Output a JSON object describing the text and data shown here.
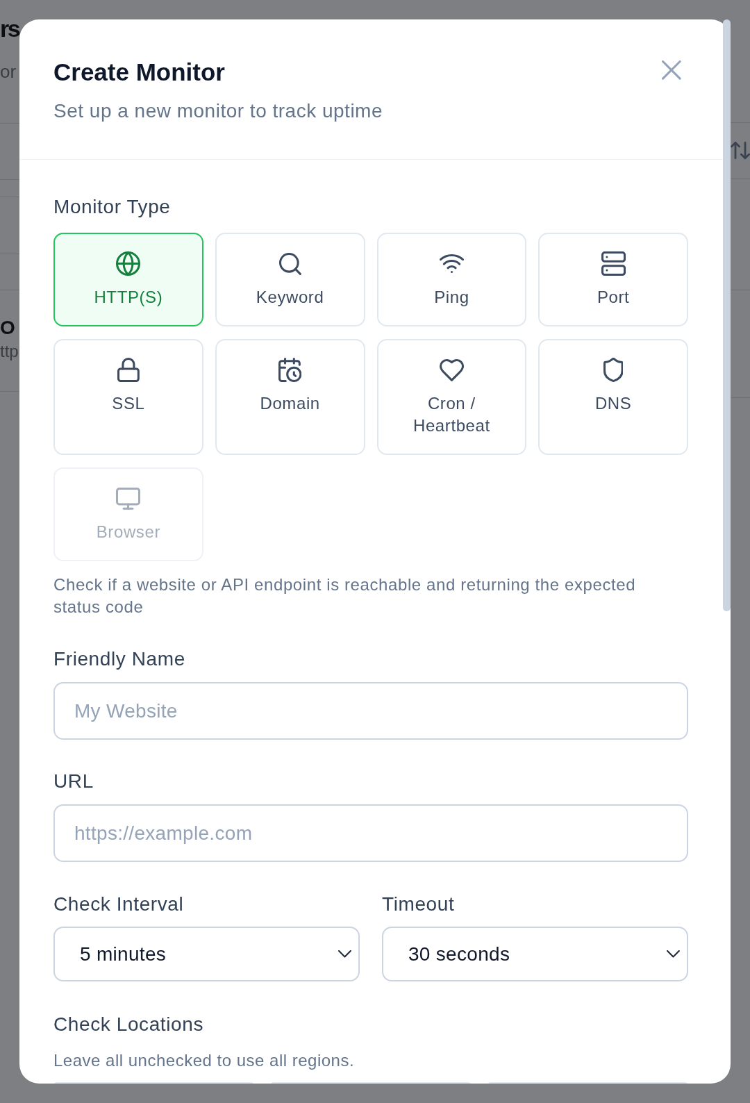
{
  "backdrop": {
    "page_title": "rs",
    "page_subtitle": "or",
    "monitor_name": "O",
    "monitor_url": "ttp"
  },
  "dialog": {
    "title": "Create Monitor",
    "subtitle": "Set up a new monitor to track uptime"
  },
  "monitor_type": {
    "label": "Monitor Type",
    "options": [
      {
        "label": "HTTP(S)",
        "selected": true,
        "disabled": false
      },
      {
        "label": "Keyword",
        "selected": false,
        "disabled": false
      },
      {
        "label": "Ping",
        "selected": false,
        "disabled": false
      },
      {
        "label": "Port",
        "selected": false,
        "disabled": false
      },
      {
        "label": "SSL",
        "selected": false,
        "disabled": false
      },
      {
        "label": "Domain",
        "selected": false,
        "disabled": false
      },
      {
        "label": "Cron / Heartbeat",
        "selected": false,
        "disabled": false
      },
      {
        "label": "DNS",
        "selected": false,
        "disabled": false
      },
      {
        "label": "Browser",
        "selected": false,
        "disabled": true
      }
    ],
    "description": "Check if a website or API endpoint is reachable and returning the expected status code"
  },
  "friendly_name": {
    "label": "Friendly Name",
    "placeholder": "My Website"
  },
  "url": {
    "label": "URL",
    "placeholder": "https://example.com"
  },
  "check_interval": {
    "label": "Check Interval",
    "value": "5 minutes"
  },
  "timeout": {
    "label": "Timeout",
    "value": "30 seconds"
  },
  "check_locations": {
    "label": "Check Locations",
    "hint": "Leave all unchecked to use all regions.",
    "options": [
      {
        "kind": "card"
      },
      {
        "kind": "card"
      },
      {
        "kind": "card"
      }
    ]
  }
}
